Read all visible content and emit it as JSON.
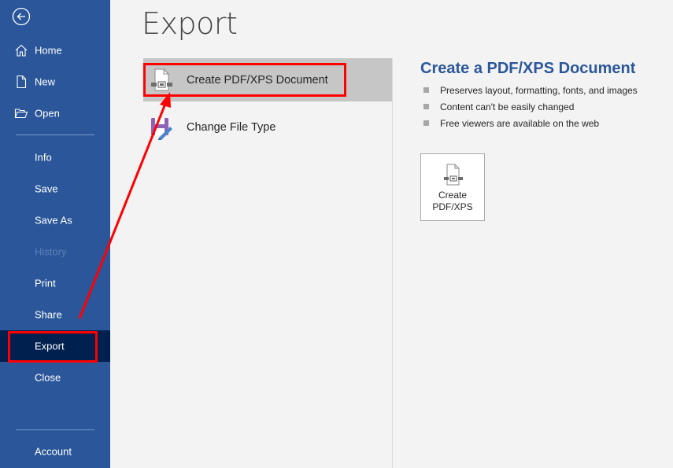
{
  "sidebar": {
    "back_icon": "back-arrow-circle-icon",
    "items": [
      {
        "id": "home",
        "label": "Home",
        "icon": "home-icon",
        "state": "normal"
      },
      {
        "id": "new",
        "label": "New",
        "icon": "new-document-icon",
        "state": "normal"
      },
      {
        "id": "open",
        "label": "Open",
        "icon": "open-folder-icon",
        "state": "normal"
      },
      {
        "id": "info",
        "label": "Info",
        "state": "normal"
      },
      {
        "id": "save",
        "label": "Save",
        "state": "normal"
      },
      {
        "id": "save-as",
        "label": "Save As",
        "state": "normal"
      },
      {
        "id": "history",
        "label": "History",
        "state": "disabled"
      },
      {
        "id": "print",
        "label": "Print",
        "state": "normal"
      },
      {
        "id": "share",
        "label": "Share",
        "state": "normal"
      },
      {
        "id": "export",
        "label": "Export",
        "state": "active"
      },
      {
        "id": "close",
        "label": "Close",
        "state": "normal"
      },
      {
        "id": "account",
        "label": "Account",
        "state": "normal"
      }
    ]
  },
  "main": {
    "title": "Export",
    "options": [
      {
        "label": "Create PDF/XPS Document",
        "icon": "pdf-document-icon",
        "selected": true
      },
      {
        "label": "Change File Type",
        "icon": "change-file-type-icon",
        "selected": false
      }
    ],
    "detail": {
      "title": "Create a PDF/XPS Document",
      "bullets": [
        "Preserves layout, formatting, fonts, and images",
        "Content can't be easily changed",
        "Free viewers are available on the web"
      ],
      "button": {
        "line1": "Create",
        "line2": "PDF/XPS",
        "icon": "pdf-document-icon"
      }
    }
  },
  "annotations": {
    "highlight_color": "#ff0000",
    "highlighted": [
      "sidebar-item-export",
      "option-create-pdf-xps"
    ],
    "arrow": "from Export menu item to Create PDF/XPS Document option"
  },
  "colors": {
    "sidebar_bg": "#2b579a",
    "sidebar_active": "#002050",
    "accent_title": "#2b579a",
    "selected_option_bg": "#c6c6c6",
    "page_bg": "#f3f3f3"
  }
}
